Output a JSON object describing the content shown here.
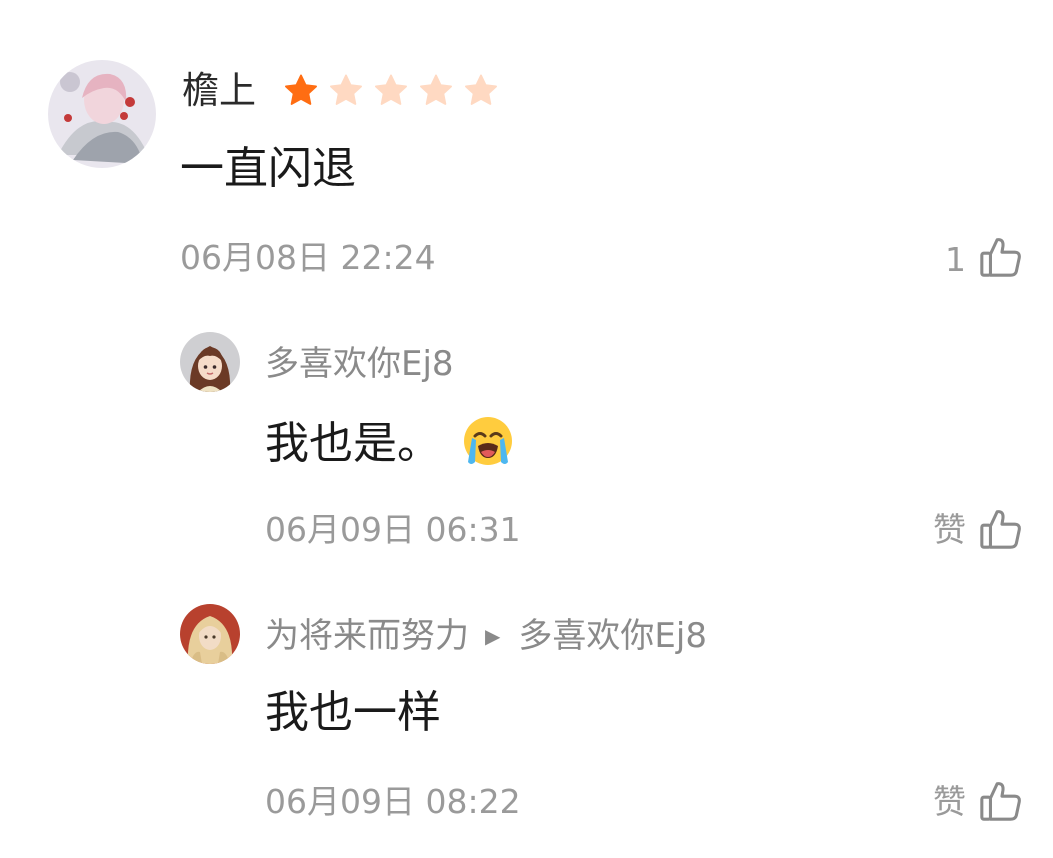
{
  "comments": [
    {
      "username": "檐上",
      "rating": 1,
      "rating_max": 5,
      "text": "一直闪退",
      "time": "06月08日 22:24",
      "likes": "1"
    }
  ],
  "replies": [
    {
      "username": "多喜欢你Ej8",
      "reply_to": "",
      "text": "我也是。",
      "emoji": "😭",
      "time": "06月09日 06:31",
      "like_label": "赞"
    },
    {
      "username": "为将来而努力",
      "reply_to": "多喜欢你Ej8",
      "text": "我也一样",
      "time": "06月09日 08:22",
      "like_label": "赞"
    }
  ],
  "colors": {
    "star_filled": "#ff6d12",
    "star_empty": "#ffd9c2",
    "muted": "#9a9a9a"
  },
  "icons": {
    "reply_arrow": "▶",
    "like": "thumbs-up-icon"
  }
}
